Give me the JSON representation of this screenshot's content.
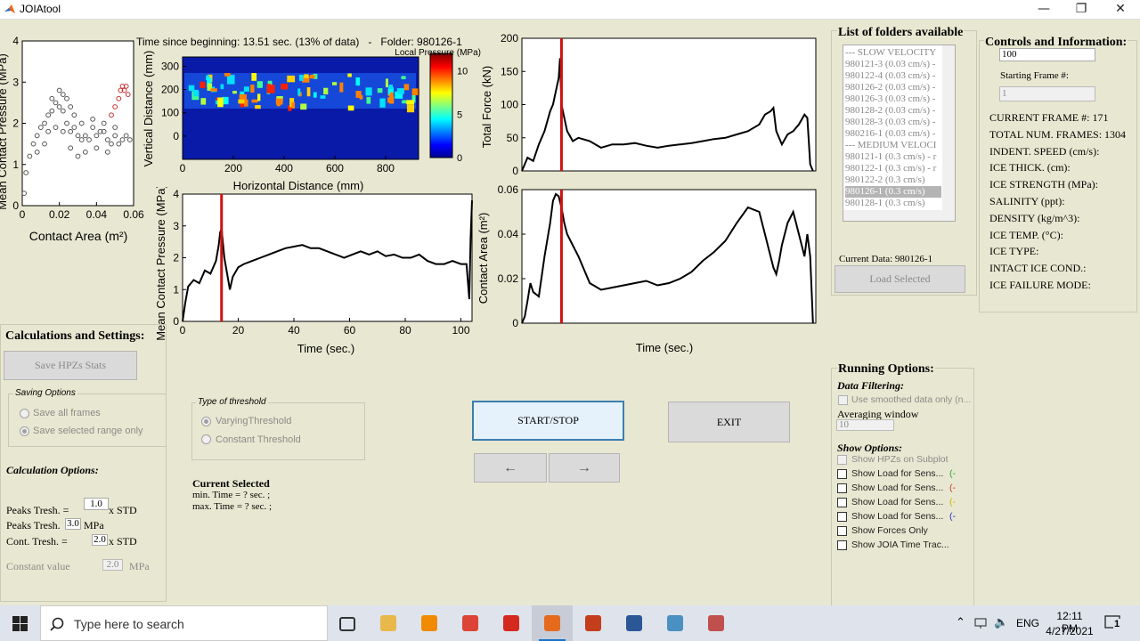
{
  "window": {
    "title": "JOIAtool"
  },
  "plots": {
    "scatter": {
      "ylabel": "Mean Contact Pressure (MPa)",
      "xlabel": "Contact Area (m²)",
      "xticks": [
        "0",
        "0.02",
        "0.04",
        "0.06"
      ],
      "yticks": [
        "0",
        "1",
        "2",
        "3",
        "4"
      ]
    },
    "heatmap": {
      "ylabel": "Vertical Distance (mm)",
      "xlabel": "Horizontal Distance (mm)",
      "xticks": [
        "0",
        "200",
        "400",
        "600",
        "800"
      ],
      "yticks": [
        "0",
        "100",
        "200",
        "300"
      ],
      "colorbar_label": "Local Pressure (MPa)",
      "colorbar_ticks": [
        "0",
        "5",
        "10"
      ]
    },
    "pressure": {
      "ylabel": "Mean Contact Pressure (MPa)",
      "xlabel": "Time (sec.)",
      "xticks": [
        "0",
        "20",
        "40",
        "60",
        "80",
        "100"
      ],
      "yticks": [
        "0",
        "1",
        "2",
        "3",
        "4"
      ]
    },
    "force": {
      "ylabel": "Total Force (kN)",
      "yticks": [
        "0",
        "50",
        "100",
        "150",
        "200"
      ]
    },
    "area": {
      "ylabel": "Contact Area (m²)",
      "xlabel": "Time (sec.)",
      "yticks": [
        "0",
        "0.02",
        "0.04",
        "0.06"
      ]
    }
  },
  "chart_data": [
    {
      "type": "scatter",
      "title": "",
      "xlabel": "Contact Area (m²)",
      "ylabel": "Mean Contact Pressure (MPa)",
      "xlim": [
        0,
        0.06
      ],
      "ylim": [
        0,
        4
      ],
      "series": [
        {
          "color": "#555555",
          "points": [
            [
              0.001,
              0.3
            ],
            [
              0.002,
              0.8
            ],
            [
              0.004,
              1.2
            ],
            [
              0.006,
              1.5
            ],
            [
              0.008,
              1.7
            ],
            [
              0.01,
              1.9
            ],
            [
              0.012,
              2.0
            ],
            [
              0.014,
              2.2
            ],
            [
              0.016,
              2.3
            ],
            [
              0.018,
              2.5
            ],
            [
              0.02,
              2.4
            ],
            [
              0.022,
              2.3
            ],
            [
              0.024,
              2.0
            ],
            [
              0.026,
              1.8
            ],
            [
              0.028,
              1.9
            ],
            [
              0.03,
              1.7
            ],
            [
              0.032,
              1.6
            ],
            [
              0.034,
              1.7
            ],
            [
              0.036,
              1.6
            ],
            [
              0.038,
              1.9
            ],
            [
              0.04,
              1.7
            ],
            [
              0.042,
              1.8
            ],
            [
              0.044,
              1.8
            ],
            [
              0.046,
              1.6
            ],
            [
              0.048,
              1.5
            ],
            [
              0.05,
              1.7
            ],
            [
              0.052,
              1.5
            ],
            [
              0.054,
              1.6
            ],
            [
              0.056,
              1.7
            ],
            [
              0.058,
              1.6
            ],
            [
              0.018,
              1.9
            ],
            [
              0.022,
              1.8
            ],
            [
              0.026,
              1.4
            ],
            [
              0.03,
              1.2
            ],
            [
              0.034,
              1.3
            ],
            [
              0.04,
              1.4
            ],
            [
              0.046,
              1.3
            ],
            [
              0.05,
              1.9
            ],
            [
              0.044,
              2.0
            ],
            [
              0.038,
              2.1
            ],
            [
              0.032,
              2.0
            ],
            [
              0.028,
              2.2
            ],
            [
              0.024,
              2.6
            ],
            [
              0.02,
              2.8
            ],
            [
              0.016,
              2.6
            ],
            [
              0.022,
              2.7
            ],
            [
              0.026,
              2.4
            ],
            [
              0.014,
              1.8
            ],
            [
              0.012,
              1.5
            ],
            [
              0.008,
              1.3
            ]
          ]
        },
        {
          "color": "#c83232",
          "points": [
            [
              0.048,
              2.2
            ],
            [
              0.05,
              2.4
            ],
            [
              0.052,
              2.6
            ],
            [
              0.053,
              2.8
            ],
            [
              0.054,
              2.9
            ],
            [
              0.055,
              2.8
            ],
            [
              0.056,
              2.9
            ],
            [
              0.057,
              2.7
            ]
          ]
        }
      ]
    },
    {
      "type": "heatmap",
      "title": "",
      "xlabel": "Horizontal Distance (mm)",
      "ylabel": "Vertical Distance (mm)",
      "xlim": [
        0,
        930
      ],
      "ylim": [
        -100,
        340
      ],
      "colorbar_label": "Local Pressure (MPa)",
      "zlim": [
        0,
        12
      ]
    },
    {
      "type": "line",
      "title": "",
      "xlabel": "Time (sec.)",
      "ylabel": "Mean Contact Pressure (MPa)",
      "xlim": [
        0,
        104
      ],
      "ylim": [
        0,
        4
      ],
      "x": [
        0,
        1,
        2,
        4,
        6,
        8,
        10,
        12,
        13,
        13.5,
        14,
        15,
        16,
        17,
        18,
        20,
        22,
        25,
        28,
        31,
        34,
        37,
        40,
        43,
        46,
        49,
        52,
        55,
        58,
        61,
        64,
        67,
        70,
        73,
        76,
        79,
        82,
        85,
        88,
        91,
        94,
        97,
        100,
        102,
        103,
        103.5,
        104
      ],
      "series": [
        {
          "values": [
            0,
            0.6,
            1.1,
            1.3,
            1.2,
            1.6,
            1.5,
            1.9,
            2.4,
            2.8,
            2.9,
            2.0,
            1.5,
            1.0,
            1.4,
            1.7,
            1.8,
            1.9,
            2.0,
            2.1,
            2.2,
            2.3,
            2.35,
            2.4,
            2.3,
            2.3,
            2.2,
            2.1,
            2.0,
            2.1,
            2.2,
            2.1,
            2.2,
            2.05,
            2.1,
            2.0,
            2.0,
            2.1,
            1.9,
            1.8,
            1.8,
            1.9,
            1.8,
            1.8,
            0.7,
            2.6,
            3.8
          ],
          "color": "#000000"
        }
      ],
      "marker_x": 14
    },
    {
      "type": "line",
      "title": "",
      "xlabel": "",
      "ylabel": "Total Force (kN)",
      "xlim": [
        0,
        104
      ],
      "ylim": [
        0,
        200
      ],
      "x": [
        0,
        2,
        4,
        6,
        8,
        10,
        11,
        12,
        13,
        13.5,
        14,
        15,
        16,
        18,
        20,
        24,
        28,
        32,
        36,
        40,
        44,
        48,
        52,
        56,
        60,
        64,
        68,
        72,
        76,
        80,
        84,
        86,
        88,
        89,
        90,
        92,
        94,
        96,
        98,
        100,
        101,
        102,
        103
      ],
      "series": [
        {
          "values": [
            0,
            20,
            15,
            40,
            60,
            90,
            100,
            120,
            140,
            170,
            100,
            80,
            60,
            45,
            50,
            45,
            35,
            40,
            40,
            42,
            38,
            35,
            38,
            40,
            42,
            45,
            48,
            50,
            55,
            60,
            70,
            85,
            90,
            95,
            60,
            40,
            55,
            60,
            70,
            85,
            80,
            10,
            0
          ],
          "color": "#000000"
        }
      ],
      "marker_x": 14
    },
    {
      "type": "line",
      "title": "",
      "xlabel": "Time (sec.)",
      "ylabel": "Contact Area (m²)",
      "xlim": [
        0,
        104
      ],
      "ylim": [
        0,
        0.06
      ],
      "x": [
        0,
        1,
        2,
        3,
        4,
        6,
        8,
        10,
        11,
        12,
        13,
        14,
        15,
        16,
        18,
        20,
        24,
        28,
        32,
        36,
        40,
        44,
        48,
        52,
        56,
        60,
        64,
        68,
        72,
        76,
        80,
        84,
        86,
        88,
        89,
        90,
        91,
        92,
        94,
        96,
        98,
        100,
        101,
        102,
        103
      ],
      "series": [
        {
          "values": [
            0,
            0.003,
            0.01,
            0.018,
            0.014,
            0.012,
            0.03,
            0.045,
            0.055,
            0.058,
            0.057,
            0.052,
            0.045,
            0.04,
            0.035,
            0.03,
            0.018,
            0.015,
            0.016,
            0.017,
            0.018,
            0.019,
            0.017,
            0.018,
            0.02,
            0.023,
            0.028,
            0.032,
            0.037,
            0.045,
            0.052,
            0.05,
            0.04,
            0.03,
            0.025,
            0.022,
            0.028,
            0.035,
            0.045,
            0.05,
            0.04,
            0.03,
            0.04,
            0.03,
            0
          ]
        }
      ],
      "marker_x": 14
    }
  ],
  "header": {
    "time_text": "Time since beginning: 13.51 sec. (13% of data)   -   Folder: 980126-1"
  },
  "left": {
    "section_title": "Calculations and Settings:",
    "save_button": "Save HPZs Stats",
    "saving_label": "Saving Options",
    "save_all": "Save all frames",
    "save_range": "Save selected range only",
    "calc_options": "Calculation Options:",
    "peaks_label": "Peaks Tresh. =",
    "peaks_value": "1.0",
    "peaks_unit": "x STD",
    "peaks2_label": "Peaks Tresh.",
    "peaks2_value": "3.0",
    "peaks2_unit": "MPa",
    "cont_label": "Cont. Tresh. =",
    "cont_value": "2.0",
    "cont_unit": "x STD",
    "const_label": "Constant value",
    "const_value": "2.0",
    "const_unit": "MPa"
  },
  "threshold": {
    "label": "Type of threshold",
    "varying": "VaryingThreshold",
    "constant": "Constant Threshold",
    "current_title": "Current Selected",
    "min_time": "min. Time = ? sec.  ;",
    "max_time": "max. Time = ? sec.  ;"
  },
  "controls_center": {
    "start_stop": "START/STOP",
    "exit": "EXIT",
    "prev": "←",
    "next": "→"
  },
  "folders": {
    "title": "List of folders available",
    "items": [
      "--- SLOW VELOCITY",
      "980121-3 (0.03 cm/s) -",
      "980122-4 (0.03 cm/s) -",
      "980126-2 (0.03 cm/s) -",
      "980126-3 (0.03 cm/s) -",
      "980128-2 (0.03 cm/s) -",
      "980128-3 (0.03 cm/s) -",
      "980216-1 (0.03 cm/s) -",
      "--- MEDIUM VELOCI",
      "980121-1 (0.3 cm/s) - r",
      "980122-1 (0.3 cm/s) - r",
      "980122-2 (0.3 cm/s)",
      "980126-1 (0.3 cm/s)",
      "980128-1 (0.3 cm/s)"
    ],
    "selected_index": 12,
    "current_data": "Current Data: 980126-1",
    "load_button": "Load Selected"
  },
  "controls": {
    "title": "Controls and Information:",
    "top_value": "100",
    "start_frame_label": "Starting Frame #:",
    "start_frame_value": "1",
    "info": [
      "CURRENT FRAME #: 171",
      "TOTAL NUM. FRAMES: 1304",
      "INDENT. SPEED (cm/s):",
      "ICE THICK. (cm):",
      "ICE STRENGTH (MPa):",
      "SALINITY (ppt):",
      "DENSITY (kg/m^3):",
      "ICE TEMP. (°C):",
      "ICE TYPE:",
      "INTACT ICE COND.:",
      "ICE FAILURE MODE:"
    ]
  },
  "running": {
    "title": "Running Options:",
    "filtering": "Data Filtering:",
    "smoothed": "Use smoothed data only (n...",
    "avg_label": "Averaging window",
    "avg_value": "10",
    "show_options": "Show Options:",
    "options": [
      {
        "label": "Show HPZs on Subplot",
        "disabled": true,
        "suffix": "",
        "color": ""
      },
      {
        "label": "Show Load for Sens...",
        "disabled": false,
        "suffix": "(-",
        "color": "#2aa52a"
      },
      {
        "label": "Show Load for Sens...",
        "disabled": false,
        "suffix": "(-",
        "color": "#c83232"
      },
      {
        "label": "Show Load for Sens...",
        "disabled": false,
        "suffix": "(-",
        "color": "#c8b400"
      },
      {
        "label": "Show Load for Sens...",
        "disabled": false,
        "suffix": "(-",
        "color": "#2a2ac8"
      },
      {
        "label": "Show Forces Only",
        "disabled": false,
        "suffix": "",
        "color": ""
      },
      {
        "label": "Show JOIA Time Trac...",
        "disabled": false,
        "suffix": "",
        "color": ""
      }
    ]
  },
  "taskbar": {
    "search_placeholder": "Type here to search",
    "time": "12:11 PM",
    "date": "4/27/2021",
    "lang": "ENG",
    "notification_count": "1",
    "apps": [
      "task-view",
      "file-explorer",
      "vlc",
      "chrome",
      "acrobat",
      "matlab",
      "powerpoint",
      "word",
      "paint",
      "weather"
    ]
  }
}
